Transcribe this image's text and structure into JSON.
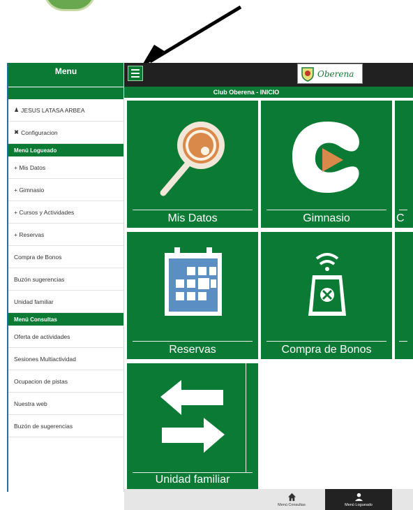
{
  "sidebar": {
    "title": "Menu",
    "user": "JESUS LATASA ARBEA",
    "config": "Configuracion",
    "section_logueado": "Menú Logueado",
    "logueado_items": [
      "+ Mis Datos",
      "+ Gimnasio",
      "+ Cursos y Actividades",
      "+ Reservas",
      "Compra de Bonos",
      "Buzón sugerencias",
      "Unidad familiar"
    ],
    "section_consultas": "Menú Consultas",
    "consultas_items": [
      "Oferta de actividades",
      "Sesiones Multiactividad",
      "Ocupacion de pistas",
      "Nuestra web",
      "Buzón de sugerencias"
    ]
  },
  "header": {
    "brand": "Oberena",
    "subtitle": "Club Oberena - INICIO"
  },
  "tiles": {
    "mis_datos": "Mis Datos",
    "gimnasio": "Gimnasio",
    "partial_1": "C",
    "reservas": "Reservas",
    "compra_bonos": "Compra de Bonos",
    "unidad_familiar": "Unidad familiar"
  },
  "bottom_nav": {
    "consultas": "Menú Consultas",
    "logueado": "Menú Logueado"
  },
  "colors": {
    "primary_green": "#0b7a34",
    "topbar_dark": "#212121",
    "accent_orange": "#d9894a",
    "calendar_blue": "#5b8fc4"
  }
}
